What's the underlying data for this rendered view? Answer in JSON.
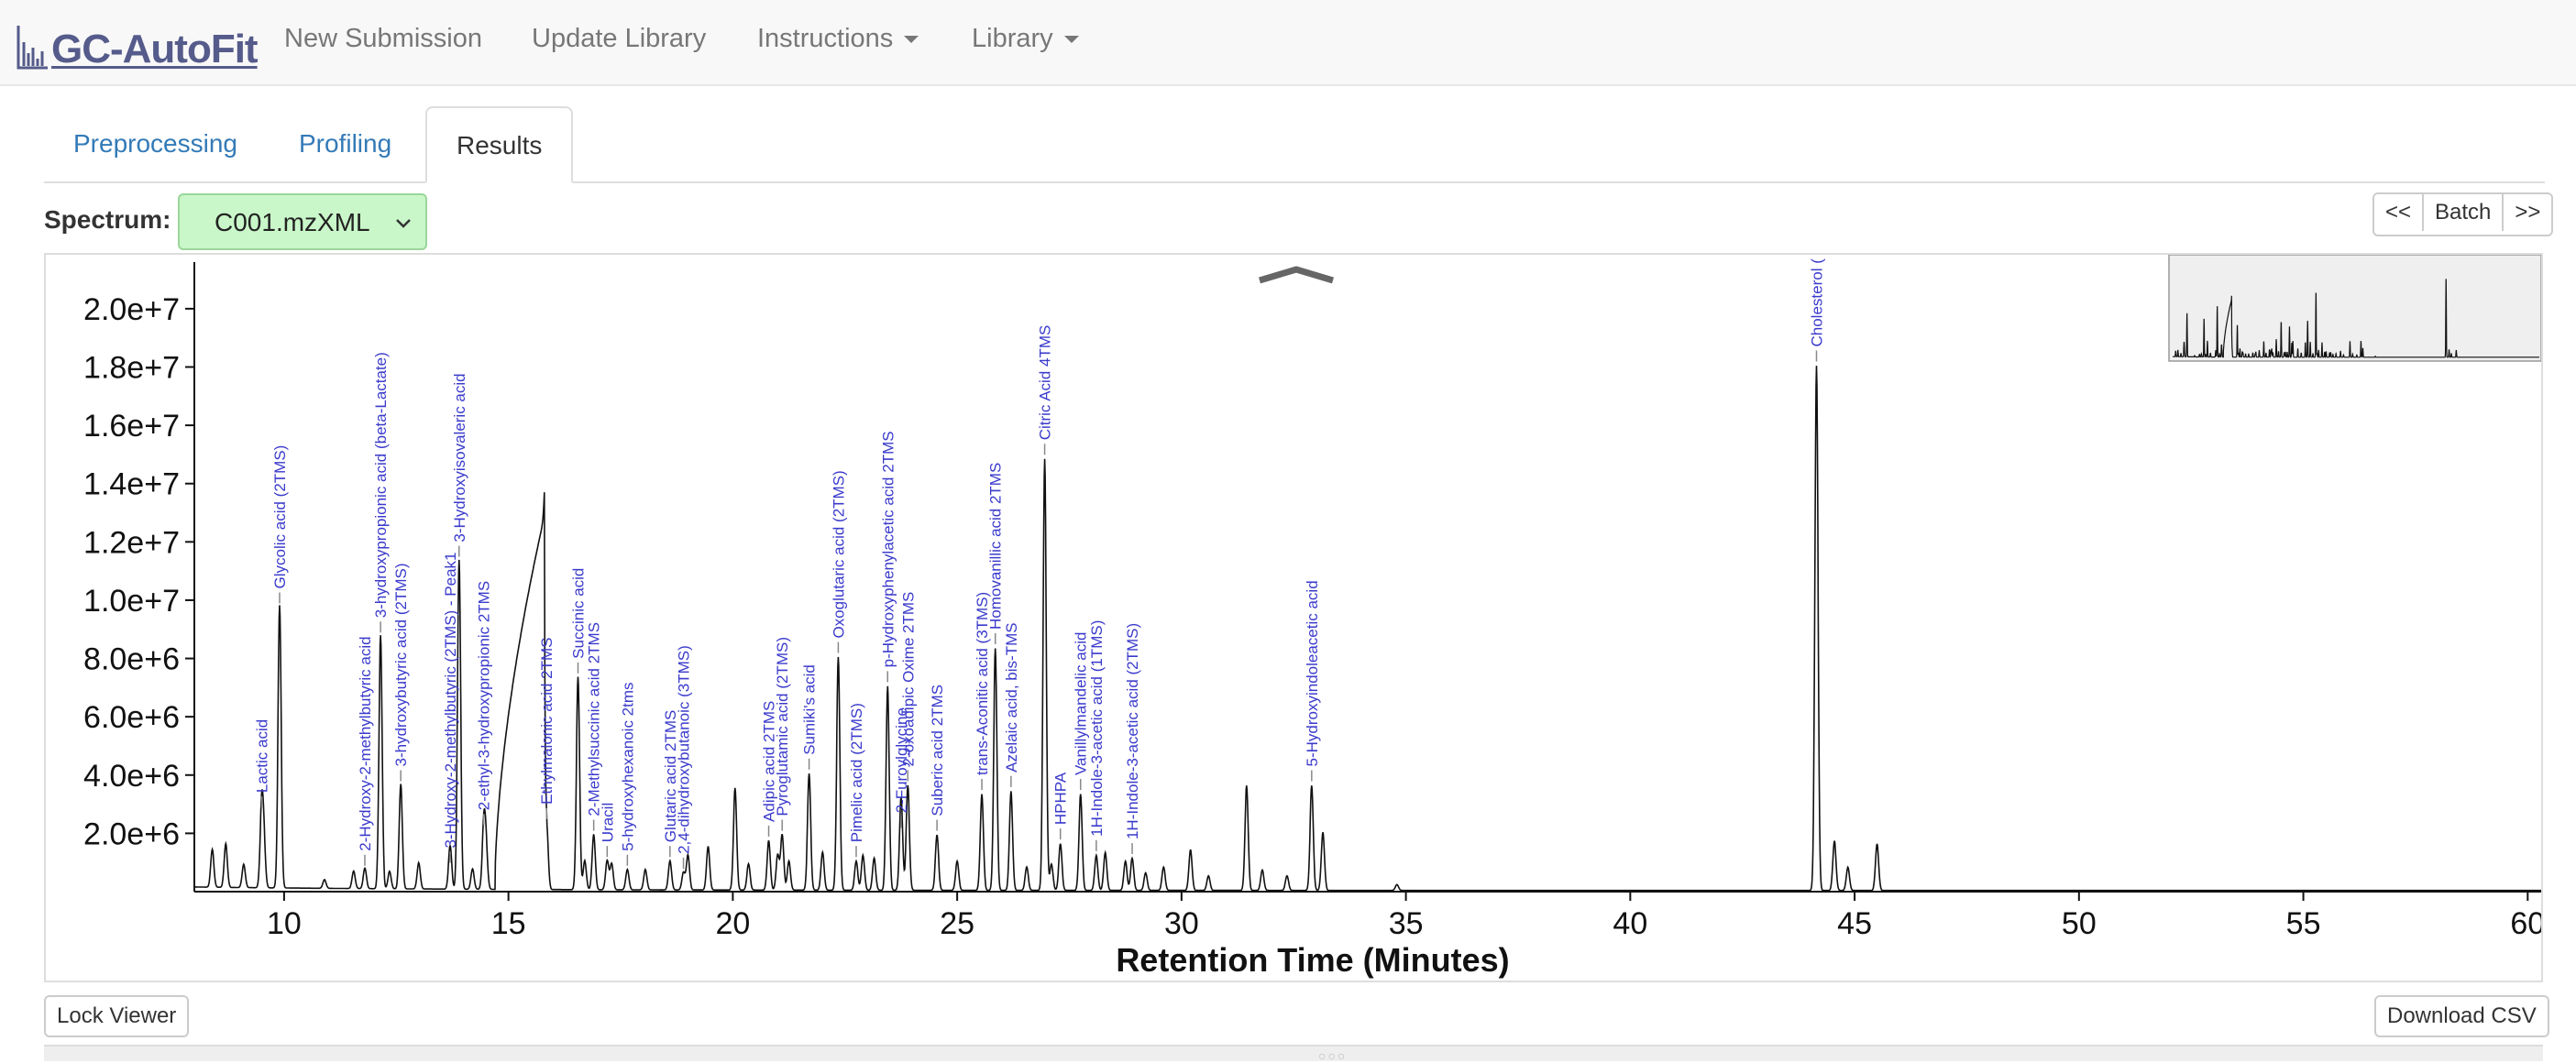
{
  "navbar": {
    "brand": "GC-AutoFit",
    "items": [
      {
        "label": "New Submission",
        "dropdown": false
      },
      {
        "label": "Update Library",
        "dropdown": false
      },
      {
        "label": "Instructions",
        "dropdown": true
      },
      {
        "label": "Library",
        "dropdown": true
      }
    ]
  },
  "tabs": [
    {
      "label": "Preprocessing",
      "active": false
    },
    {
      "label": "Profiling",
      "active": false
    },
    {
      "label": "Results",
      "active": true
    }
  ],
  "spectrum": {
    "label": "Spectrum:",
    "selected": "C001.mzXML"
  },
  "batch": {
    "prev": "<<",
    "label": "Batch",
    "next": ">>"
  },
  "buttons": {
    "lock": "Lock Viewer",
    "download": "Download CSV"
  },
  "colors": {
    "label": "#3a3acc",
    "trace": "#111111",
    "select_bg": "#c9f7c9",
    "link": "#337ab7"
  },
  "chart_data": {
    "type": "line",
    "xlabel": "Retention Time (Minutes)",
    "xlim": [
      8,
      60.3
    ],
    "ylim": [
      0,
      21600000
    ],
    "x_ticks": [
      10,
      15,
      20,
      25,
      30,
      35,
      40,
      45,
      50,
      55,
      60
    ],
    "y_ticks": [
      {
        "v": 2000000,
        "label": "2.0e+6"
      },
      {
        "v": 4000000,
        "label": "4.0e+6"
      },
      {
        "v": 6000000,
        "label": "6.0e+6"
      },
      {
        "v": 8000000,
        "label": "8.0e+6"
      },
      {
        "v": 10000000,
        "label": "1.0e+7"
      },
      {
        "v": 12000000,
        "label": "1.2e+7"
      },
      {
        "v": 14000000,
        "label": "1.4e+7"
      },
      {
        "v": 16000000,
        "label": "1.6e+7"
      },
      {
        "v": 18000000,
        "label": "1.8e+7"
      },
      {
        "v": 20000000,
        "label": "2.0e+7"
      }
    ],
    "peaks": [
      {
        "x": 8.4,
        "y": 1300000
      },
      {
        "x": 8.7,
        "y": 1500000
      },
      {
        "x": 9.1,
        "y": 800000
      },
      {
        "x": 9.55,
        "y": 1500000
      },
      {
        "x": 10.9,
        "y": 300000
      },
      {
        "x": 11.55,
        "y": 600000
      },
      {
        "x": 12.35,
        "y": 600000
      },
      {
        "x": 13.0,
        "y": 900000
      },
      {
        "x": 13.7,
        "y": 700000
      },
      {
        "x": 14.2,
        "y": 700000
      },
      {
        "x": 14.5,
        "y": 1400000
      },
      {
        "x": 16.7,
        "y": 1000000
      },
      {
        "x": 17.3,
        "y": 900000
      },
      {
        "x": 18.05,
        "y": 700000
      },
      {
        "x": 19.0,
        "y": 1200000
      },
      {
        "x": 19.45,
        "y": 1500000
      },
      {
        "x": 20.35,
        "y": 900000
      },
      {
        "x": 21.0,
        "y": 1200000
      },
      {
        "x": 21.25,
        "y": 1000000
      },
      {
        "x": 22.0,
        "y": 1300000
      },
      {
        "x": 22.9,
        "y": 1200000
      },
      {
        "x": 23.15,
        "y": 1100000
      },
      {
        "x": 23.75,
        "y": 1200000
      },
      {
        "x": 25.0,
        "y": 1000000
      },
      {
        "x": 26.55,
        "y": 800000
      },
      {
        "x": 27.1,
        "y": 900000
      },
      {
        "x": 28.3,
        "y": 1300000
      },
      {
        "x": 28.75,
        "y": 1000000
      },
      {
        "x": 29.2,
        "y": 600000
      },
      {
        "x": 29.6,
        "y": 800000
      },
      {
        "x": 30.2,
        "y": 1400000
      },
      {
        "x": 30.6,
        "y": 500000
      },
      {
        "x": 31.45,
        "y": 3600000
      },
      {
        "x": 31.8,
        "y": 700000
      },
      {
        "x": 32.35,
        "y": 500000
      },
      {
        "x": 33.15,
        "y": 2000000
      },
      {
        "x": 34.8,
        "y": 200000
      },
      {
        "x": 44.55,
        "y": 1700000
      },
      {
        "x": 44.85,
        "y": 800000
      },
      {
        "x": 45.5,
        "y": 1600000
      }
    ],
    "labeled_peaks": [
      {
        "x": 9.5,
        "y": 2700000,
        "label": "Lactic acid"
      },
      {
        "x": 9.9,
        "y": 9700000,
        "label": "Glycolic acid (2TMS)"
      },
      {
        "x": 11.8,
        "y": 700000,
        "label": "2-Hydroxy-2-methylbutyric acid"
      },
      {
        "x": 12.15,
        "y": 8700000,
        "label": "3-hydroxypropionic acid (beta-Lactate)"
      },
      {
        "x": 12.6,
        "y": 3600000,
        "label": "3-hydroxybutyric acid (2TMS)"
      },
      {
        "x": 13.7,
        "y": 800000,
        "label": "3-Hydroxy-2-methylbutyric (2TMS) - Peak1"
      },
      {
        "x": 13.9,
        "y": 11300000,
        "label": "3-Hydroxyisovaleric acid"
      },
      {
        "x": 14.45,
        "y": 2100000,
        "label": "2-ethyl-3-hydroxypropionic 2TMS"
      },
      {
        "x": 15.85,
        "y": 2300000,
        "label": "Ethylmalonic acid 2TMS"
      },
      {
        "x": 16.55,
        "y": 7300000,
        "label": "Succinic acid"
      },
      {
        "x": 16.9,
        "y": 1900000,
        "label": "2-Methylsuccinic acid 2TMS"
      },
      {
        "x": 17.2,
        "y": 1000000,
        "label": "Uracil"
      },
      {
        "x": 17.65,
        "y": 700000,
        "label": "5-hydroxyhexanoic 2tms"
      },
      {
        "x": 18.6,
        "y": 1000000,
        "label": "Glutaric acid 2TMS"
      },
      {
        "x": 18.9,
        "y": 600000,
        "label": "2,4-dihydroxybutanoic (3TMS)"
      },
      {
        "x": 20.05,
        "y": 3500000,
        "label": ""
      },
      {
        "x": 20.8,
        "y": 1700000,
        "label": "Adipic acid 2TMS"
      },
      {
        "x": 21.1,
        "y": 1900000,
        "label": "Pyroglutamic acid (2TMS)"
      },
      {
        "x": 21.7,
        "y": 4000000,
        "label": "Sumiki's acid"
      },
      {
        "x": 22.35,
        "y": 8000000,
        "label": "Oxoglutaric acid (2TMS)"
      },
      {
        "x": 22.75,
        "y": 1000000,
        "label": "Pimelic acid (2TMS)"
      },
      {
        "x": 23.45,
        "y": 7000000,
        "label": "p-Hydroxyphenylacetic acid 2TMS"
      },
      {
        "x": 23.75,
        "y": 2000000,
        "label": "2-Furoylglycine"
      },
      {
        "x": 23.9,
        "y": 3600000,
        "label": "2-oxoadipic Oxime 2TMS"
      },
      {
        "x": 24.55,
        "y": 1900000,
        "label": "Suberic acid 2TMS"
      },
      {
        "x": 25.55,
        "y": 3300000,
        "label": "trans-Aconitic acid (3TMS)"
      },
      {
        "x": 25.85,
        "y": 8300000,
        "label": "Homovanillic acid 2TMS"
      },
      {
        "x": 26.2,
        "y": 3400000,
        "label": "Azelaic acid, bis-TMS"
      },
      {
        "x": 26.95,
        "y": 14800000,
        "label": "Citric Acid 4TMS"
      },
      {
        "x": 27.3,
        "y": 1600000,
        "label": "HPHPA"
      },
      {
        "x": 27.75,
        "y": 3300000,
        "label": "Vanillylmandelic acid"
      },
      {
        "x": 28.1,
        "y": 1200000,
        "label": "1H-Indole-3-acetic acid (1TMS)"
      },
      {
        "x": 28.9,
        "y": 1100000,
        "label": "1H-Indole-3-acetic acid (2TMS)"
      },
      {
        "x": 32.9,
        "y": 3600000,
        "label": "5-Hydroxyindoleacetic acid"
      },
      {
        "x": 44.15,
        "y": 18000000,
        "label": "Cholesterol ("
      }
    ],
    "broad_peak": {
      "x_start": 14.7,
      "x_end": 15.8,
      "y_start": 200000,
      "y_max": 12800000
    },
    "grid": false,
    "legend": "none",
    "overview": "top-right"
  }
}
